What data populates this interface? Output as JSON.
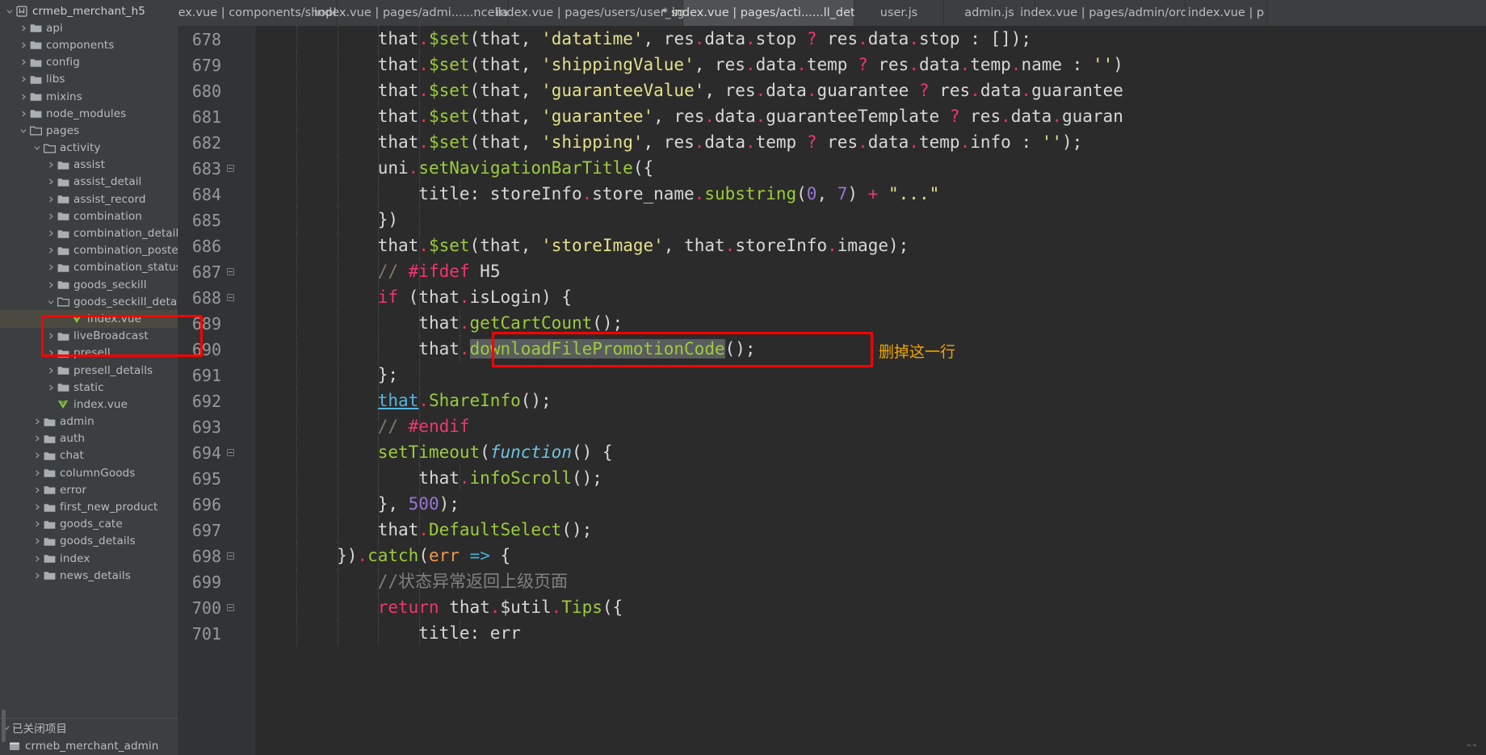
{
  "tabs": [
    {
      "label": "index.vue | components/shopList",
      "active": false,
      "modified": false
    },
    {
      "label": "index.vue | pages/admi......ncellation",
      "active": false,
      "modified": false
    },
    {
      "label": "index.vue | pages/users/user_sgin",
      "active": false,
      "modified": false
    },
    {
      "label": "* index.vue | pages/acti......ll_details",
      "active": true,
      "modified": true
    },
    {
      "label": "user.js",
      "active": false,
      "modified": false
    },
    {
      "label": "admin.js",
      "active": false,
      "modified": false
    },
    {
      "label": "index.vue | pages/admin/order",
      "active": false,
      "modified": false
    },
    {
      "label": "index.vue | p",
      "active": false,
      "modified": false
    }
  ],
  "sidebar": {
    "items": [
      {
        "label": "crmeb_merchant_h5",
        "depth": 0,
        "arrow": "down",
        "icon": "project-icon",
        "selected": false
      },
      {
        "label": "api",
        "depth": 1,
        "arrow": "right",
        "icon": "folder-icon",
        "selected": false
      },
      {
        "label": "components",
        "depth": 1,
        "arrow": "right",
        "icon": "folder-icon",
        "selected": false
      },
      {
        "label": "config",
        "depth": 1,
        "arrow": "right",
        "icon": "folder-icon",
        "selected": false
      },
      {
        "label": "libs",
        "depth": 1,
        "arrow": "right",
        "icon": "folder-icon",
        "selected": false
      },
      {
        "label": "mixins",
        "depth": 1,
        "arrow": "right",
        "icon": "folder-icon",
        "selected": false
      },
      {
        "label": "node_modules",
        "depth": 1,
        "arrow": "right",
        "icon": "folder-icon",
        "selected": false
      },
      {
        "label": "pages",
        "depth": 1,
        "arrow": "down",
        "icon": "folder-open-icon",
        "selected": false
      },
      {
        "label": "activity",
        "depth": 2,
        "arrow": "down",
        "icon": "folder-open-icon",
        "selected": false
      },
      {
        "label": "assist",
        "depth": 3,
        "arrow": "right",
        "icon": "folder-icon",
        "selected": false
      },
      {
        "label": "assist_detail",
        "depth": 3,
        "arrow": "right",
        "icon": "folder-icon",
        "selected": false
      },
      {
        "label": "assist_record",
        "depth": 3,
        "arrow": "right",
        "icon": "folder-icon",
        "selected": false
      },
      {
        "label": "combination",
        "depth": 3,
        "arrow": "right",
        "icon": "folder-icon",
        "selected": false
      },
      {
        "label": "combination_details",
        "depth": 3,
        "arrow": "right",
        "icon": "folder-icon",
        "selected": false
      },
      {
        "label": "combination_poster",
        "depth": 3,
        "arrow": "right",
        "icon": "folder-icon",
        "selected": false
      },
      {
        "label": "combination_status",
        "depth": 3,
        "arrow": "right",
        "icon": "folder-icon",
        "selected": false
      },
      {
        "label": "goods_seckill",
        "depth": 3,
        "arrow": "right",
        "icon": "folder-icon",
        "selected": false
      },
      {
        "label": "goods_seckill_details",
        "depth": 3,
        "arrow": "down",
        "icon": "folder-open-icon",
        "selected": false
      },
      {
        "label": "index.vue",
        "depth": 4,
        "arrow": "none",
        "icon": "vue-file-icon",
        "selected": true
      },
      {
        "label": "liveBroadcast",
        "depth": 3,
        "arrow": "right",
        "icon": "folder-icon",
        "selected": false
      },
      {
        "label": "presell",
        "depth": 3,
        "arrow": "right",
        "icon": "folder-icon",
        "selected": false
      },
      {
        "label": "presell_details",
        "depth": 3,
        "arrow": "right",
        "icon": "folder-icon",
        "selected": false
      },
      {
        "label": "static",
        "depth": 3,
        "arrow": "right",
        "icon": "folder-icon",
        "selected": false
      },
      {
        "label": "index.vue",
        "depth": 3,
        "arrow": "none",
        "icon": "vue-file-icon",
        "selected": false
      },
      {
        "label": "admin",
        "depth": 2,
        "arrow": "right",
        "icon": "folder-icon",
        "selected": false
      },
      {
        "label": "auth",
        "depth": 2,
        "arrow": "right",
        "icon": "folder-icon",
        "selected": false
      },
      {
        "label": "chat",
        "depth": 2,
        "arrow": "right",
        "icon": "folder-icon",
        "selected": false
      },
      {
        "label": "columnGoods",
        "depth": 2,
        "arrow": "right",
        "icon": "folder-icon",
        "selected": false
      },
      {
        "label": "error",
        "depth": 2,
        "arrow": "right",
        "icon": "folder-icon",
        "selected": false
      },
      {
        "label": "first_new_product",
        "depth": 2,
        "arrow": "right",
        "icon": "folder-icon",
        "selected": false
      },
      {
        "label": "goods_cate",
        "depth": 2,
        "arrow": "right",
        "icon": "folder-icon",
        "selected": false
      },
      {
        "label": "goods_details",
        "depth": 2,
        "arrow": "right",
        "icon": "folder-icon",
        "selected": false
      },
      {
        "label": "index",
        "depth": 2,
        "arrow": "right",
        "icon": "folder-icon",
        "selected": false
      },
      {
        "label": "news_details",
        "depth": 2,
        "arrow": "right",
        "icon": "folder-icon",
        "selected": false
      }
    ],
    "closed_projects": {
      "header": "已关闭项目",
      "items": [
        {
          "label": "crmeb_merchant_admin",
          "icon": "project-closed-icon"
        }
      ]
    }
  },
  "editor": {
    "first_line_number": 678,
    "lines": [
      {
        "num": 678,
        "fold": false,
        "indent_guides": 4
      },
      {
        "num": 679,
        "fold": false,
        "indent_guides": 4
      },
      {
        "num": 680,
        "fold": false,
        "indent_guides": 4
      },
      {
        "num": 681,
        "fold": false,
        "indent_guides": 4
      },
      {
        "num": 682,
        "fold": false,
        "indent_guides": 4
      },
      {
        "num": 683,
        "fold": true,
        "indent_guides": 4
      },
      {
        "num": 684,
        "fold": false,
        "indent_guides": 5
      },
      {
        "num": 685,
        "fold": false,
        "indent_guides": 4
      },
      {
        "num": 686,
        "fold": false,
        "indent_guides": 4
      },
      {
        "num": 687,
        "fold": true,
        "indent_guides": 4
      },
      {
        "num": 688,
        "fold": true,
        "indent_guides": 4
      },
      {
        "num": 689,
        "fold": false,
        "indent_guides": 5
      },
      {
        "num": 690,
        "fold": false,
        "indent_guides": 5
      },
      {
        "num": 691,
        "fold": false,
        "indent_guides": 4
      },
      {
        "num": 692,
        "fold": false,
        "indent_guides": 4
      },
      {
        "num": 693,
        "fold": false,
        "indent_guides": 4
      },
      {
        "num": 694,
        "fold": true,
        "indent_guides": 4
      },
      {
        "num": 695,
        "fold": false,
        "indent_guides": 5
      },
      {
        "num": 696,
        "fold": false,
        "indent_guides": 4
      },
      {
        "num": 697,
        "fold": false,
        "indent_guides": 4
      },
      {
        "num": 698,
        "fold": true,
        "indent_guides": 3
      },
      {
        "num": 699,
        "fold": false,
        "indent_guides": 4
      },
      {
        "num": 700,
        "fold": true,
        "indent_guides": 4
      },
      {
        "num": 701,
        "fold": false,
        "indent_guides": 5
      }
    ],
    "code_text": [
      "            that.$set(that, 'datatime', res.data.stop ? res.data.stop : []);",
      "            that.$set(that, 'shippingValue', res.data.temp ? res.data.temp.name : '')",
      "            that.$set(that, 'guaranteeValue', res.data.guarantee ? res.data.guarantee",
      "            that.$set(that, 'guarantee', res.data.guaranteeTemplate ? res.data.guaran",
      "            that.$set(that, 'shipping', res.data.temp ? res.data.temp.info : '');",
      "            uni.setNavigationBarTitle({",
      "                title: storeInfo.store_name.substring(0, 7) + \"...\"",
      "            })",
      "            that.$set(that, 'storeImage', that.storeInfo.image);",
      "            // #ifdef H5",
      "            if (that.isLogin) {",
      "                that.getCartCount();",
      "                that.downloadFilePromotionCode();",
      "            };",
      "            that.ShareInfo();",
      "            // #endif",
      "            setTimeout(function() {",
      "                that.infoScroll();",
      "            }, 500);",
      "            that.DefaultSelect();",
      "        }).catch(err => {",
      "            //状态异常返回上级页面",
      "            return that.$util.Tips({",
      "                title: err"
    ]
  },
  "annotations": {
    "code_note": "删掉这一行",
    "note_color": "#f0a500",
    "box_color": "#ff0000"
  },
  "status": {
    "corner_glyph": "⌁⌁"
  }
}
